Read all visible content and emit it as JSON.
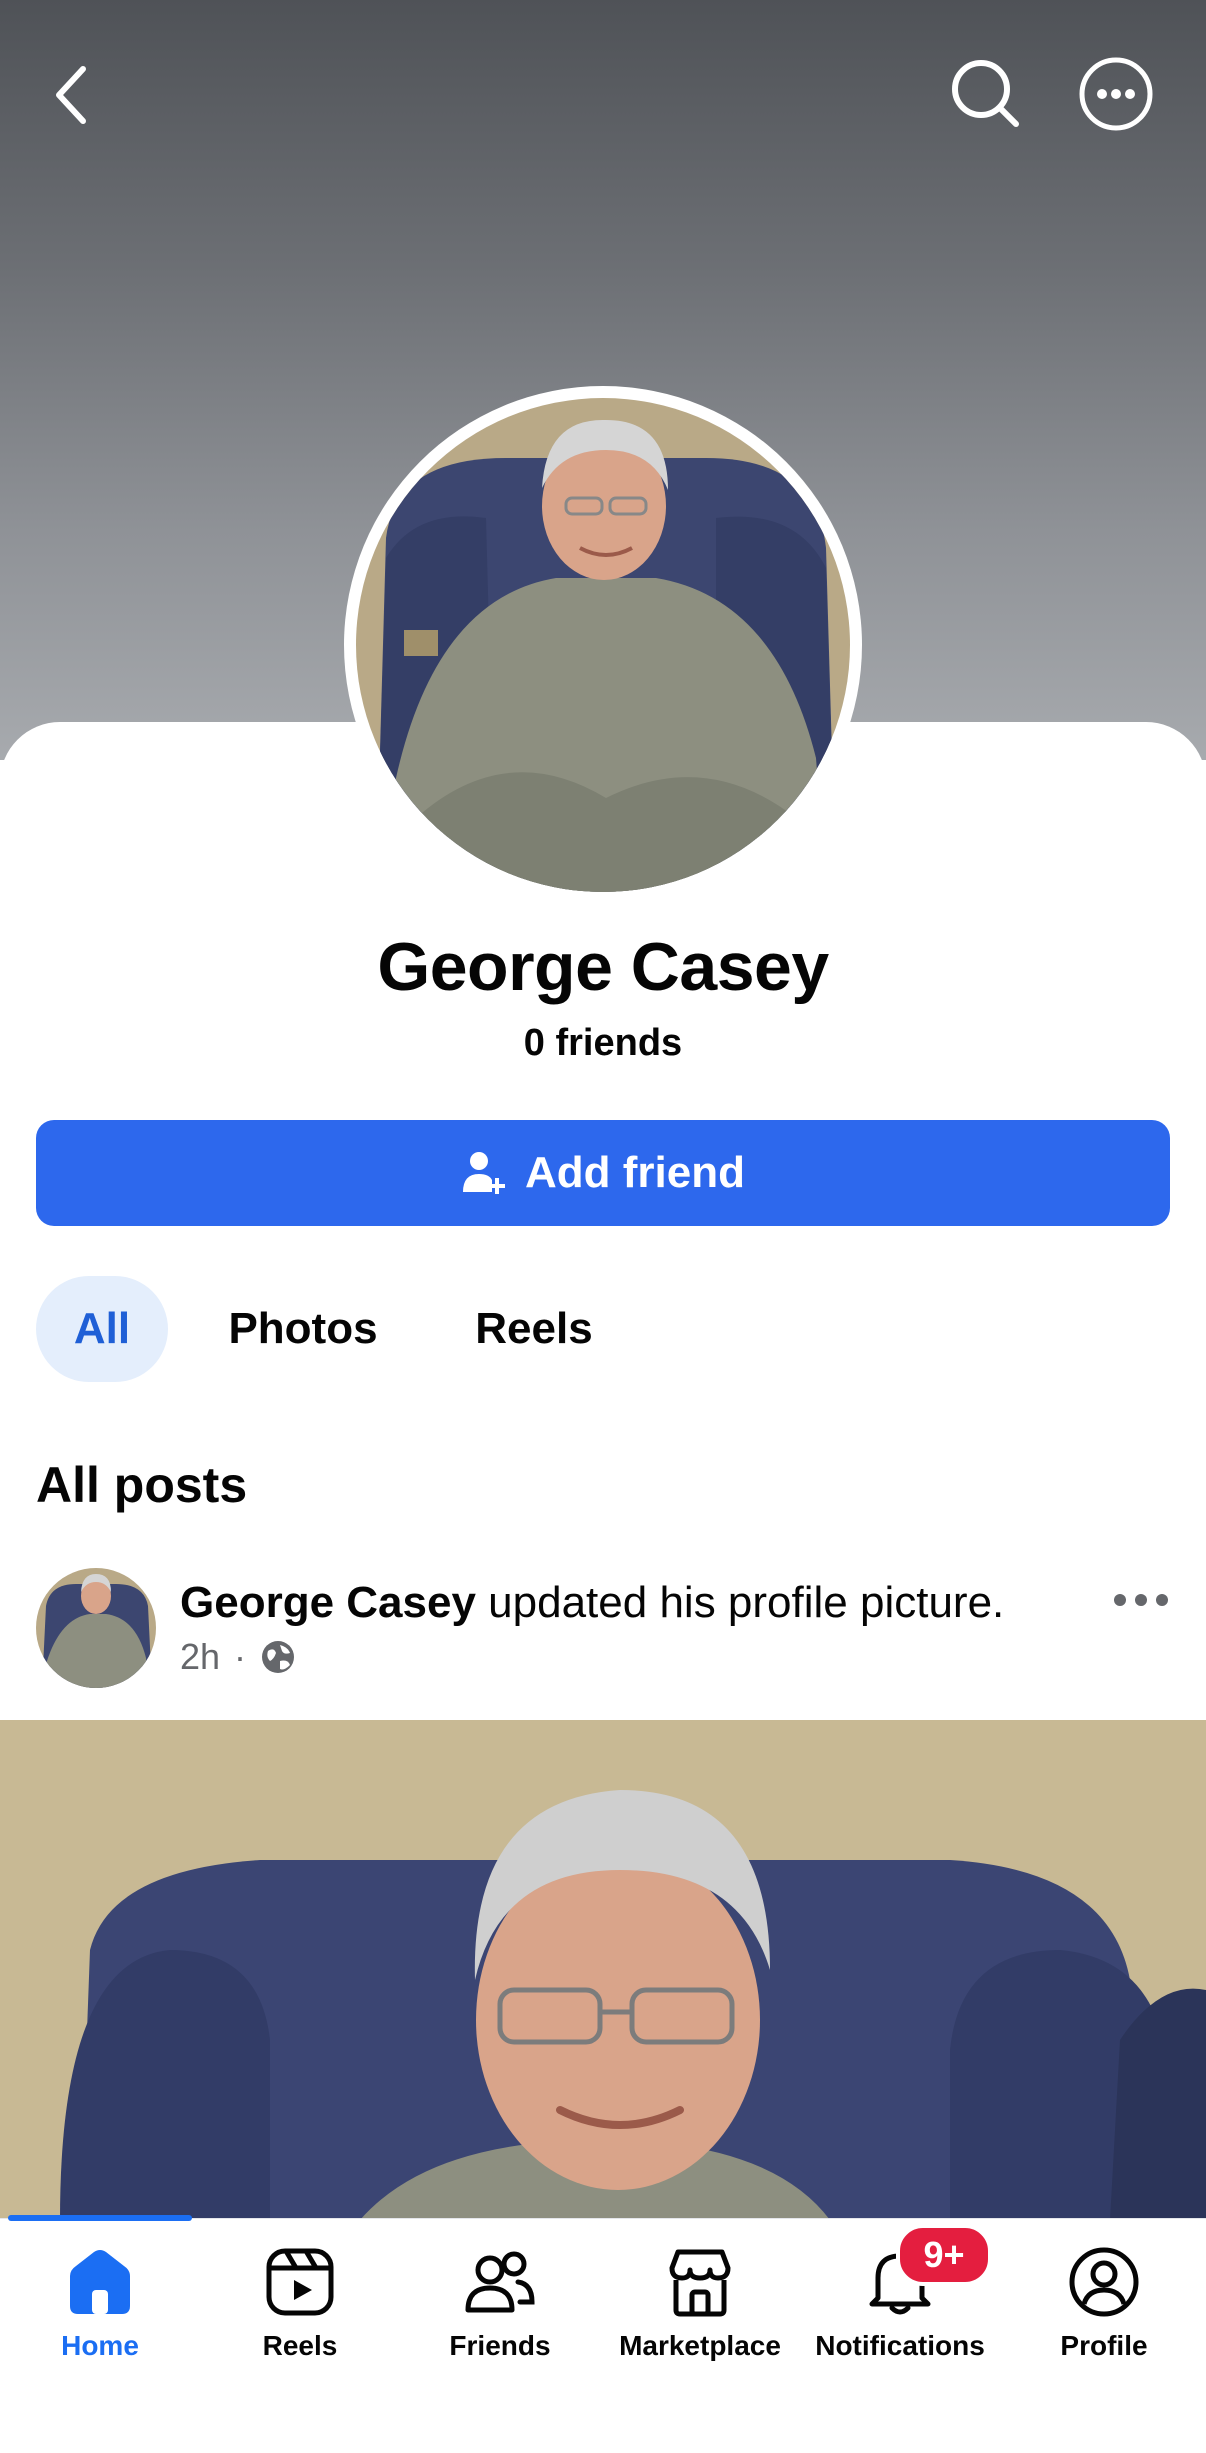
{
  "topbar": {
    "back_icon": "chevron-left-icon",
    "search_icon": "search-icon",
    "more_icon": "more-circle-icon"
  },
  "profile": {
    "name": "George Casey",
    "friends_count": "0 friends",
    "add_friend_label": "Add friend",
    "add_friend_icon": "person-add-icon"
  },
  "tabs": [
    {
      "label": "All",
      "active": true
    },
    {
      "label": "Photos",
      "active": false
    },
    {
      "label": "Reels",
      "active": false
    }
  ],
  "feed": {
    "section_title": "All posts",
    "post": {
      "author": "George Casey",
      "action": "updated his profile picture.",
      "time": "2h",
      "separator": "·",
      "audience_icon": "globe-icon",
      "more_icon": "ellipsis-icon"
    }
  },
  "nav": {
    "items": [
      {
        "label": "Home",
        "icon": "home-icon",
        "active": true
      },
      {
        "label": "Reels",
        "icon": "reels-icon",
        "active": false
      },
      {
        "label": "Friends",
        "icon": "friends-icon",
        "active": false
      },
      {
        "label": "Marketplace",
        "icon": "marketplace-icon",
        "active": false
      },
      {
        "label": "Notifications",
        "icon": "bell-icon",
        "active": false,
        "badge": "9+"
      },
      {
        "label": "Profile",
        "icon": "profile-icon",
        "active": false
      }
    ]
  },
  "colors": {
    "accent": "#2d68ed",
    "tab_active_bg": "#e4eefc",
    "badge": "#e41e3f",
    "nav_active": "#1b6ef3"
  }
}
